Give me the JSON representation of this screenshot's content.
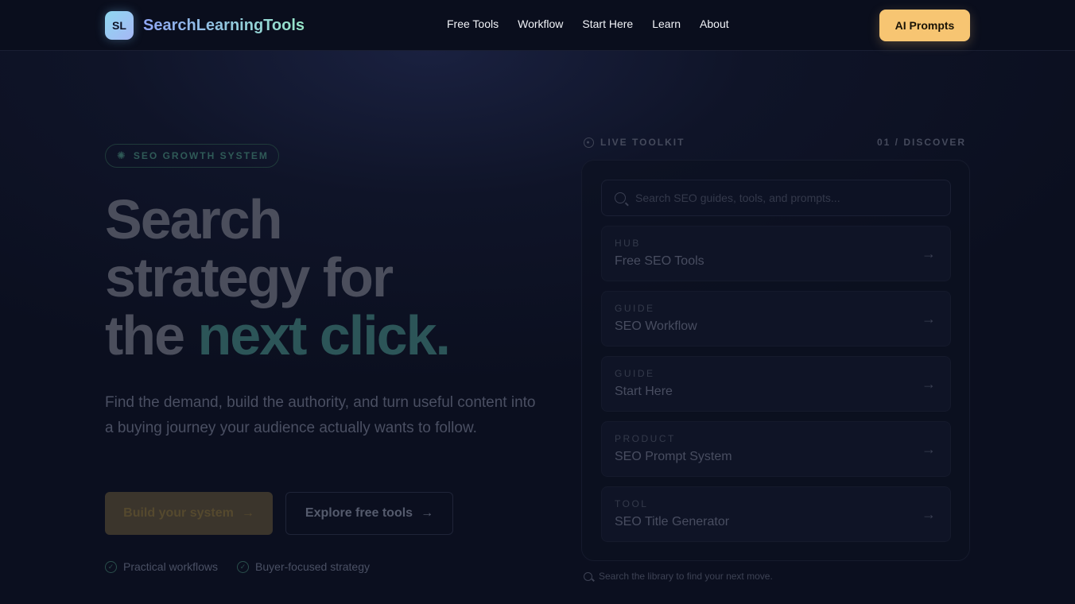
{
  "header": {
    "logo_initials": "SL",
    "brand": "SearchLearningTools",
    "nav": [
      "Free Tools",
      "Workflow",
      "Start Here",
      "Learn",
      "About"
    ],
    "cta": "AI Prompts"
  },
  "hero": {
    "badge": "SEO GROWTH SYSTEM",
    "headline_line1": "Search",
    "headline_line2": "strategy for",
    "headline_line3_a": "the",
    "headline_line3_b": "next click.",
    "lede": "Find the demand, build the authority, and turn useful content into a buying journey your audience actually wants to follow.",
    "primary_button": "Build your system",
    "secondary_button": "Explore free tools",
    "checks": [
      "Practical workflows",
      "Buyer-focused strategy"
    ]
  },
  "toolkit": {
    "label": "LIVE TOOLKIT",
    "step": "01 / DISCOVER",
    "search_placeholder": "Search SEO guides, tools, and prompts...",
    "search_value": "",
    "items": [
      {
        "kicker": "HUB",
        "title": "Free SEO Tools"
      },
      {
        "kicker": "GUIDE",
        "title": "SEO Workflow"
      },
      {
        "kicker": "GUIDE",
        "title": "Start Here"
      },
      {
        "kicker": "PRODUCT",
        "title": "SEO Prompt System"
      },
      {
        "kicker": "TOOL",
        "title": "SEO Title Generator"
      }
    ],
    "footer": "Search the library to find your next move."
  },
  "colors": {
    "background": "#0f1428",
    "accent_cta": "#f7c572",
    "accent_teal": "#2c5558"
  },
  "icons": {
    "badge": "sparkle-icon",
    "arrow": "arrow-right-icon",
    "check": "check-circle-icon",
    "search": "search-icon",
    "live": "clock-icon"
  }
}
